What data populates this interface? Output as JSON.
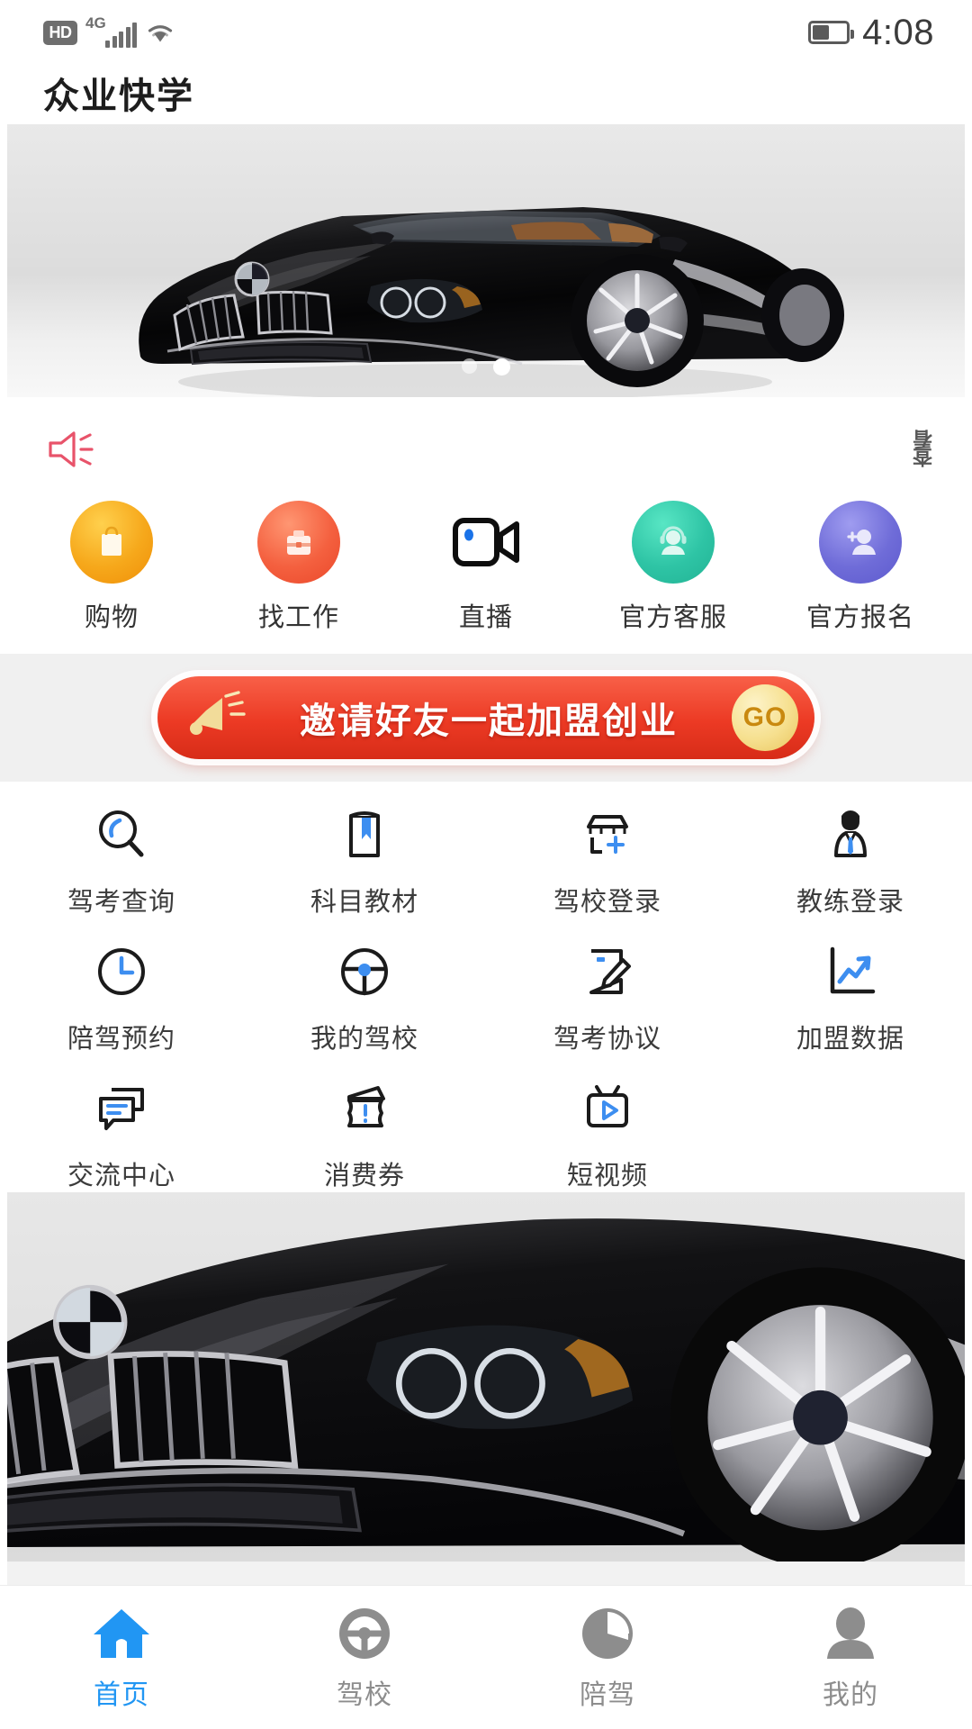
{
  "status_bar": {
    "hd_badge": "HD",
    "network_type": "4G",
    "signal_icon": "signal-bars-icon",
    "wifi_icon": "wifi-icon",
    "battery_icon": "battery-icon",
    "time": "4:08"
  },
  "app_bar": {
    "title": "众业快学"
  },
  "carousel": {
    "slide_alt": "black-bmw-convertible-banner",
    "dots": 2,
    "active_index": 1
  },
  "notice": {
    "horn_icon": "megaphone-icon",
    "more_label": "查看",
    "accent_color": "#e8536a"
  },
  "quick_access": {
    "items": [
      {
        "label": "购物",
        "icon": "shopping-bag-icon",
        "color": "#f2a619"
      },
      {
        "label": "找工作",
        "icon": "briefcase-icon",
        "color": "#f05a3c"
      },
      {
        "label": "直播",
        "icon": "video-camera-icon",
        "color": "#111111"
      },
      {
        "label": "官方客服",
        "icon": "headset-support-icon",
        "color": "#2ec4a5"
      },
      {
        "label": "官方报名",
        "icon": "add-user-icon",
        "color": "#6d6ad6"
      }
    ]
  },
  "invite_banner": {
    "text": "邀请好友一起加盟创业",
    "button_label": "GO",
    "horn_icon": "megaphone-icon",
    "bg_color": "#ec3a24",
    "button_color": "#f0d387"
  },
  "feature_grid": {
    "items": [
      {
        "label": "驾考查询",
        "icon": "magnifier-icon"
      },
      {
        "label": "科目教材",
        "icon": "book-bookmark-icon"
      },
      {
        "label": "驾校登录",
        "icon": "shop-plus-icon"
      },
      {
        "label": "教练登录",
        "icon": "person-tie-icon"
      },
      {
        "label": "陪驾预约",
        "icon": "clock-icon"
      },
      {
        "label": "我的驾校",
        "icon": "steering-wheel-icon"
      },
      {
        "label": "驾考协议",
        "icon": "document-pen-icon"
      },
      {
        "label": "加盟数据",
        "icon": "trend-chart-icon"
      },
      {
        "label": "交流中心",
        "icon": "chat-bubbles-icon"
      },
      {
        "label": "消费券",
        "icon": "coupon-icon"
      },
      {
        "label": "短视频",
        "icon": "tv-play-icon"
      }
    ],
    "accent_color": "#3d8ef0"
  },
  "bottom_banner": {
    "slide_alt": "black-bmw-front-banner"
  },
  "tab_bar": {
    "active_color": "#2196f3",
    "inactive_color": "#8d8d8d",
    "items": [
      {
        "label": "首页",
        "icon": "home-icon",
        "active": true
      },
      {
        "label": "驾校",
        "icon": "steering-wheel-icon",
        "active": false
      },
      {
        "label": "陪驾",
        "icon": "gauge-icon",
        "active": false
      },
      {
        "label": "我的",
        "icon": "person-icon",
        "active": false
      }
    ]
  }
}
